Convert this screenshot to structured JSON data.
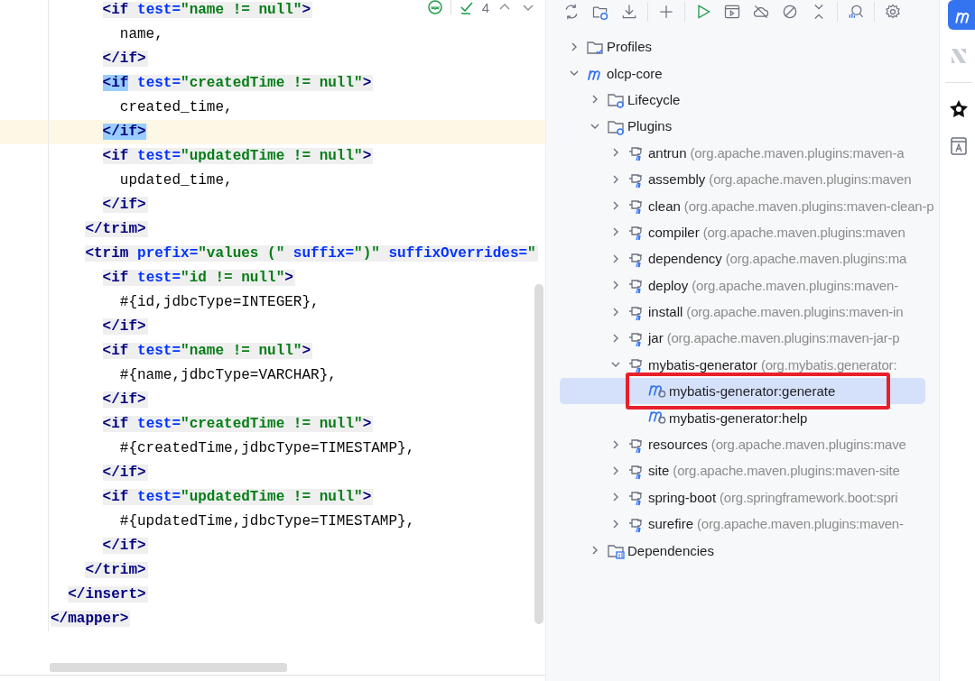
{
  "editor": {
    "inspections": {
      "count": "4"
    },
    "lines": [
      {
        "kind": "tag",
        "current": false,
        "tokens": [
          {
            "kind": "tag",
            "text": "      <if"
          },
          {
            "kind": "attr",
            "text": " test="
          },
          {
            "kind": "value",
            "text": "\"name != null\""
          },
          {
            "kind": "tag",
            "text": ">"
          }
        ]
      },
      {
        "kind": "text",
        "current": false,
        "tokens": [
          {
            "kind": "text",
            "text": "        name,"
          }
        ]
      },
      {
        "kind": "tag",
        "current": false,
        "tokens": [
          {
            "kind": "tag",
            "text": "      </if>"
          }
        ]
      },
      {
        "kind": "tag",
        "current": false,
        "tokens": [
          {
            "kind": "tag",
            "text": "      <if",
            "matched": true
          },
          {
            "kind": "attr",
            "text": " test="
          },
          {
            "kind": "value",
            "text": "\"createdTime != null\""
          },
          {
            "kind": "tag",
            "text": ">"
          }
        ]
      },
      {
        "kind": "text",
        "current": false,
        "tokens": [
          {
            "kind": "text",
            "text": "        created_time,"
          }
        ]
      },
      {
        "kind": "tag",
        "current": true,
        "tokens": [
          {
            "kind": "tag",
            "text": "      </if>",
            "matched": true
          }
        ]
      },
      {
        "kind": "tag",
        "current": false,
        "tokens": [
          {
            "kind": "tag",
            "text": "      <if"
          },
          {
            "kind": "attr",
            "text": " test="
          },
          {
            "kind": "value",
            "text": "\"updatedTime != null\""
          },
          {
            "kind": "tag",
            "text": ">"
          }
        ]
      },
      {
        "kind": "text",
        "current": false,
        "tokens": [
          {
            "kind": "text",
            "text": "        updated_time,"
          }
        ]
      },
      {
        "kind": "tag",
        "current": false,
        "tokens": [
          {
            "kind": "tag",
            "text": "      </if>"
          }
        ]
      },
      {
        "kind": "tag",
        "current": false,
        "tokens": [
          {
            "kind": "tag",
            "text": "    </trim>"
          }
        ]
      },
      {
        "kind": "tag",
        "current": false,
        "tokens": [
          {
            "kind": "tag",
            "text": "    <trim"
          },
          {
            "kind": "attr",
            "text": " prefix="
          },
          {
            "kind": "value",
            "text": "\"values (\""
          },
          {
            "kind": "attr",
            "text": " suffix="
          },
          {
            "kind": "value",
            "text": "\")\""
          },
          {
            "kind": "attr",
            "text": " suffixOverrides="
          },
          {
            "kind": "value",
            "text": "\""
          }
        ]
      },
      {
        "kind": "tag",
        "current": false,
        "tokens": [
          {
            "kind": "tag",
            "text": "      <if"
          },
          {
            "kind": "attr",
            "text": " test="
          },
          {
            "kind": "value",
            "text": "\"id != null\""
          },
          {
            "kind": "tag",
            "text": ">"
          }
        ]
      },
      {
        "kind": "text",
        "current": false,
        "tokens": [
          {
            "kind": "text",
            "text": "        #{id,jdbcType=INTEGER},"
          }
        ]
      },
      {
        "kind": "tag",
        "current": false,
        "tokens": [
          {
            "kind": "tag",
            "text": "      </if>"
          }
        ]
      },
      {
        "kind": "tag",
        "current": false,
        "tokens": [
          {
            "kind": "tag",
            "text": "      <if"
          },
          {
            "kind": "attr",
            "text": " test="
          },
          {
            "kind": "value",
            "text": "\"name != null\""
          },
          {
            "kind": "tag",
            "text": ">"
          }
        ]
      },
      {
        "kind": "text",
        "current": false,
        "tokens": [
          {
            "kind": "text",
            "text": "        #{name,jdbcType=VARCHAR},"
          }
        ]
      },
      {
        "kind": "tag",
        "current": false,
        "tokens": [
          {
            "kind": "tag",
            "text": "      </if>"
          }
        ]
      },
      {
        "kind": "tag",
        "current": false,
        "tokens": [
          {
            "kind": "tag",
            "text": "      <if"
          },
          {
            "kind": "attr",
            "text": " test="
          },
          {
            "kind": "value",
            "text": "\"createdTime != null\""
          },
          {
            "kind": "tag",
            "text": ">"
          }
        ]
      },
      {
        "kind": "text",
        "current": false,
        "tokens": [
          {
            "kind": "text",
            "text": "        #{createdTime,jdbcType=TIMESTAMP},"
          }
        ]
      },
      {
        "kind": "tag",
        "current": false,
        "tokens": [
          {
            "kind": "tag",
            "text": "      </if>"
          }
        ]
      },
      {
        "kind": "tag",
        "current": false,
        "tokens": [
          {
            "kind": "tag",
            "text": "      <if"
          },
          {
            "kind": "attr",
            "text": " test="
          },
          {
            "kind": "value",
            "text": "\"updatedTime != null\""
          },
          {
            "kind": "tag",
            "text": ">"
          }
        ]
      },
      {
        "kind": "text",
        "current": false,
        "tokens": [
          {
            "kind": "text",
            "text": "        #{updatedTime,jdbcType=TIMESTAMP},"
          }
        ]
      },
      {
        "kind": "tag",
        "current": false,
        "tokens": [
          {
            "kind": "tag",
            "text": "      </if>"
          }
        ]
      },
      {
        "kind": "tag",
        "current": false,
        "tokens": [
          {
            "kind": "tag",
            "text": "    </trim>"
          }
        ]
      },
      {
        "kind": "tag",
        "current": false,
        "tokens": [
          {
            "kind": "tag",
            "text": "  </insert>"
          }
        ]
      },
      {
        "kind": "tag",
        "current": false,
        "tokens": [
          {
            "kind": "tag",
            "text": "</mapper>"
          }
        ]
      }
    ]
  },
  "maven": {
    "tree": [
      {
        "kind": "folder",
        "label": "Profiles",
        "expanded": false,
        "selected": false
      },
      {
        "kind": "module",
        "label": "olcp-core",
        "expanded": true,
        "selected": false,
        "children": [
          {
            "kind": "lifecycle",
            "label": "Lifecycle",
            "expanded": false,
            "selected": false
          },
          {
            "kind": "plugins",
            "label": "Plugins",
            "expanded": true,
            "selected": false,
            "children": [
              {
                "kind": "plugin",
                "label": "antrun",
                "detail": "(org.apache.maven.plugins:maven-a",
                "expanded": false,
                "selected": false
              },
              {
                "kind": "plugin",
                "label": "assembly",
                "detail": "(org.apache.maven.plugins:maven",
                "expanded": false,
                "selected": false
              },
              {
                "kind": "plugin",
                "label": "clean",
                "detail": "(org.apache.maven.plugins:maven-clean-p",
                "expanded": false,
                "selected": false
              },
              {
                "kind": "plugin",
                "label": "compiler",
                "detail": "(org.apache.maven.plugins:maven",
                "expanded": false,
                "selected": false
              },
              {
                "kind": "plugin",
                "label": "dependency",
                "detail": "(org.apache.maven.plugins:ma",
                "expanded": false,
                "selected": false
              },
              {
                "kind": "plugin",
                "label": "deploy",
                "detail": "(org.apache.maven.plugins:maven-",
                "expanded": false,
                "selected": false
              },
              {
                "kind": "plugin",
                "label": "install",
                "detail": "(org.apache.maven.plugins:maven-in",
                "expanded": false,
                "selected": false
              },
              {
                "kind": "plugin",
                "label": "jar",
                "detail": "(org.apache.maven.plugins:maven-jar-p",
                "expanded": false,
                "selected": false
              },
              {
                "kind": "plugin",
                "label": "mybatis-generator",
                "detail": "(org.mybatis.generator:",
                "expanded": true,
                "selected": false,
                "children": [
                  {
                    "kind": "goal",
                    "label": "mybatis-generator:generate",
                    "selected": true,
                    "annotated": true
                  },
                  {
                    "kind": "goal",
                    "label": "mybatis-generator:help",
                    "selected": false,
                    "annotated": false
                  }
                ]
              },
              {
                "kind": "plugin",
                "label": "resources",
                "detail": "(org.apache.maven.plugins:mave",
                "expanded": false,
                "selected": false
              },
              {
                "kind": "plugin",
                "label": "site",
                "detail": "(org.apache.maven.plugins:maven-site",
                "expanded": false,
                "selected": false
              },
              {
                "kind": "plugin",
                "label": "spring-boot",
                "detail": "(org.springframework.boot:spri",
                "expanded": false,
                "selected": false
              },
              {
                "kind": "plugin",
                "label": "surefire",
                "detail": "(org.apache.maven.plugins:maven-",
                "expanded": false,
                "selected": false
              }
            ]
          },
          {
            "kind": "dependencies",
            "label": "Dependencies",
            "expanded": false,
            "selected": false
          }
        ]
      }
    ]
  }
}
